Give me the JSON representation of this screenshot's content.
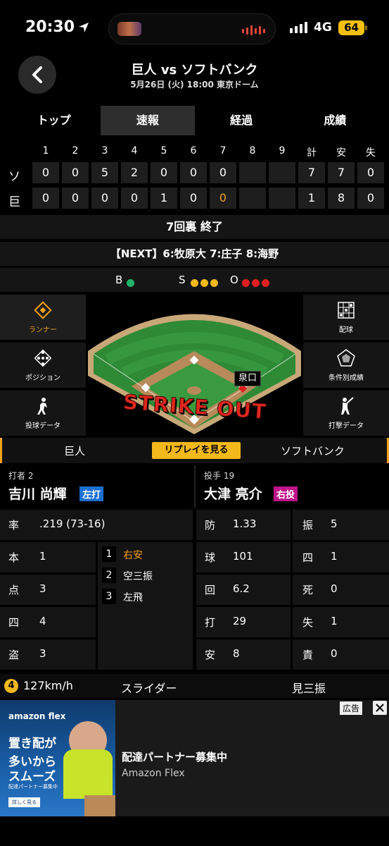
{
  "status": {
    "time": "20:30",
    "network": "4G",
    "battery": "64"
  },
  "header": {
    "title": "巨人 vs ソフトバンク",
    "subtitle": "5月26日 (火) 18:00 東京ドーム"
  },
  "tabs": [
    {
      "label": "トップ",
      "active": false
    },
    {
      "label": "速報",
      "active": true
    },
    {
      "label": "経過",
      "active": false
    },
    {
      "label": "成績",
      "active": false
    }
  ],
  "scoreboard": {
    "innings": [
      "1",
      "2",
      "3",
      "4",
      "5",
      "6",
      "7",
      "8",
      "9"
    ],
    "totals_headers": [
      "計",
      "安",
      "失"
    ],
    "rows": [
      {
        "team": "ソ",
        "scores": [
          "0",
          "0",
          "5",
          "2",
          "0",
          "0",
          "0",
          "",
          ""
        ],
        "totals": [
          "7",
          "7",
          "0"
        ]
      },
      {
        "team": "巨",
        "scores": [
          "0",
          "0",
          "0",
          "0",
          "1",
          "0",
          "0",
          "",
          ""
        ],
        "totals": [
          "1",
          "8",
          "0"
        ]
      }
    ]
  },
  "inning_status": "7回裏 終了",
  "next_batters": "【NEXT】6:牧原大 7:庄子 8:海野",
  "count": {
    "ball_label": "B",
    "strike_label": "S",
    "out_label": "O",
    "balls": 1,
    "strikes": 3,
    "outs": 3,
    "ball_color": "#1fb36a",
    "strike_color": "#f3b81a",
    "out_color": "#e02020"
  },
  "side_left": [
    {
      "label": "ランナー",
      "active": true
    },
    {
      "label": "ポジション"
    },
    {
      "label": "投球データ"
    }
  ],
  "side_right": [
    {
      "label": "配球"
    },
    {
      "label": "条件別成績"
    },
    {
      "label": "打撃データ"
    }
  ],
  "field": {
    "pitcher_tag": "泉口",
    "result_text": "STRIKE OUT"
  },
  "teambar": {
    "left": "巨人",
    "replay": "リプレイを見る",
    "right": "ソフトバンク"
  },
  "batter": {
    "label": "打者 2",
    "name": "吉川 尚輝",
    "hand": "左打",
    "avg_key": "率",
    "avg": ".219 (73-16)",
    "stats": [
      {
        "k": "本",
        "v": "1"
      },
      {
        "k": "点",
        "v": "3"
      },
      {
        "k": "四",
        "v": "4"
      },
      {
        "k": "盗",
        "v": "3"
      }
    ],
    "at_bats": [
      {
        "n": "1",
        "r": "右安"
      },
      {
        "n": "2",
        "r": "空三振"
      },
      {
        "n": "3",
        "r": "左飛"
      }
    ]
  },
  "pitcher": {
    "label": "投手 19",
    "name": "大津 亮介",
    "hand": "右投",
    "stats_left": [
      {
        "k": "防",
        "v": "1.33"
      },
      {
        "k": "球",
        "v": "101"
      },
      {
        "k": "回",
        "v": "6.2"
      },
      {
        "k": "打",
        "v": "29"
      },
      {
        "k": "安",
        "v": "8"
      }
    ],
    "stats_right": [
      {
        "k": "振",
        "v": "5"
      },
      {
        "k": "四",
        "v": "1"
      },
      {
        "k": "死",
        "v": "0"
      },
      {
        "k": "失",
        "v": "1"
      },
      {
        "k": "責",
        "v": "0"
      }
    ]
  },
  "last_pitch": {
    "num": "4",
    "speed": "127km/h",
    "type": "スライダー",
    "result": "見三振"
  },
  "ad": {
    "badge": "広告",
    "brand_small": "amazon flex",
    "copy1": "置き配が",
    "copy2": "多いから",
    "copy3": "スムーズ",
    "copy_small": "配達パートナー募集中",
    "btn": "詳しく見る",
    "title": "配達パートナー募集中",
    "subtitle": "Amazon Flex"
  }
}
